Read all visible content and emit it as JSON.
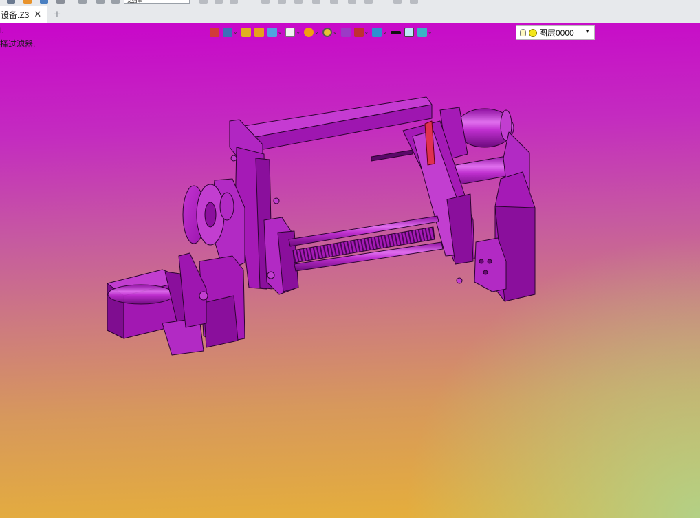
{
  "toolbar_top": {
    "filter_value": "选择"
  },
  "tabs": {
    "document_tab_label": "设备.Z3",
    "close_glyph": "✕",
    "add_glyph": "+"
  },
  "prompts": {
    "line1": "l.",
    "line2": "择过滤器."
  },
  "view_toolbar": {
    "buttons": [
      {
        "name": "exit-icon",
        "color": "#d23a3a"
      },
      {
        "name": "view-orient-icon",
        "color": "#3d6fb8"
      },
      {
        "name": "pencil-icon",
        "color": "#e0b020"
      },
      {
        "name": "shaded-box-icon",
        "color": "#e6a21e"
      },
      {
        "name": "shaded-cube-icon",
        "color": "#4fa3e0"
      },
      {
        "name": "white-cube-icon",
        "color": "#f2f2f2"
      },
      {
        "name": "render-mode-icon",
        "color": "#f0a010"
      },
      {
        "name": "zoom-icon",
        "color": "#e7c233"
      },
      {
        "name": "section-icon",
        "color": "#9c3ac6"
      },
      {
        "name": "dimension-icon",
        "color": "#c03030"
      },
      {
        "name": "display-icon",
        "color": "#2f8fd0"
      },
      {
        "name": "line-color-icon",
        "color": "#111111"
      },
      {
        "name": "fill-color-icon",
        "color": "#bfe6f7"
      },
      {
        "name": "material-icon",
        "color": "#39b3c6"
      }
    ],
    "layer_label": "图层0000"
  },
  "colors": {
    "accent": "#c806ca",
    "model_base": "#a218b2",
    "model_light": "#c634d4",
    "model_dark": "#6a0a78",
    "model_edge": "#2c0430"
  }
}
